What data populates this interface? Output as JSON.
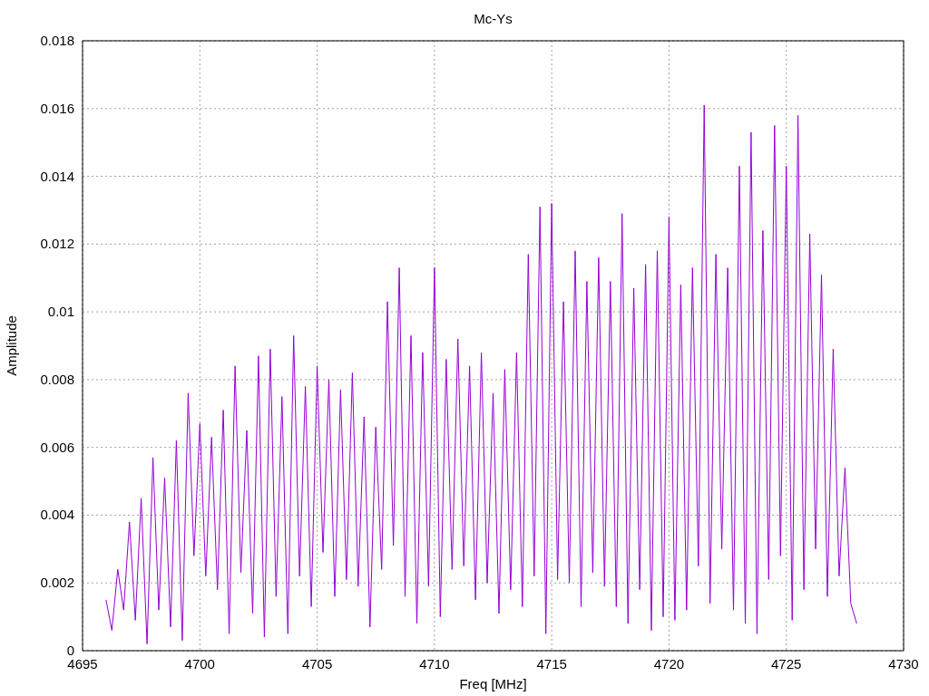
{
  "chart_data": {
    "type": "line",
    "title": "Mc-Ys",
    "xlabel": "Freq [MHz]",
    "ylabel": "Amplitude",
    "grid": true,
    "xlim": [
      4695,
      4730
    ],
    "ylim": [
      0,
      0.018
    ],
    "xticks": [
      4695,
      4700,
      4705,
      4710,
      4715,
      4720,
      4725,
      4730
    ],
    "yticks": [
      0,
      0.002,
      0.004,
      0.006,
      0.008,
      0.01,
      0.012,
      0.014,
      0.016,
      0.018
    ],
    "x": [
      4696,
      4696.25,
      4696.5,
      4696.75,
      4697,
      4697.25,
      4697.5,
      4697.75,
      4698,
      4698.25,
      4698.5,
      4698.75,
      4699,
      4699.25,
      4699.5,
      4699.75,
      4700,
      4700.25,
      4700.5,
      4700.75,
      4701,
      4701.25,
      4701.5,
      4701.75,
      4702,
      4702.25,
      4702.5,
      4702.75,
      4703,
      4703.25,
      4703.5,
      4703.75,
      4704,
      4704.25,
      4704.5,
      4704.75,
      4705,
      4705.25,
      4705.5,
      4705.75,
      4706,
      4706.25,
      4706.5,
      4706.75,
      4707,
      4707.25,
      4707.5,
      4707.75,
      4708,
      4708.25,
      4708.5,
      4708.75,
      4709,
      4709.25,
      4709.5,
      4709.75,
      4710,
      4710.25,
      4710.5,
      4710.75,
      4711,
      4711.25,
      4711.5,
      4711.75,
      4712,
      4712.25,
      4712.5,
      4712.75,
      4713,
      4713.25,
      4713.5,
      4713.75,
      4714,
      4714.25,
      4714.5,
      4714.75,
      4715,
      4715.25,
      4715.5,
      4715.75,
      4716,
      4716.25,
      4716.5,
      4716.75,
      4717,
      4717.25,
      4717.5,
      4717.75,
      4718,
      4718.25,
      4718.5,
      4718.75,
      4719,
      4719.25,
      4719.5,
      4719.75,
      4720,
      4720.25,
      4720.5,
      4720.75,
      4721,
      4721.25,
      4721.5,
      4721.75,
      4722,
      4722.25,
      4722.5,
      4722.75,
      4723,
      4723.25,
      4723.5,
      4723.75,
      4724,
      4724.25,
      4724.5,
      4724.75,
      4725,
      4725.25,
      4725.5,
      4725.75,
      4726,
      4726.25,
      4726.5,
      4726.75,
      4727,
      4727.25,
      4727.5,
      4727.75,
      4728
    ],
    "series": [
      {
        "color": "#9400d3",
        "values": [
          0.0015,
          0.0006,
          0.0024,
          0.0012,
          0.0038,
          0.0009,
          0.0045,
          0.0002,
          0.0057,
          0.0012,
          0.0051,
          0.0007,
          0.0062,
          0.0003,
          0.0076,
          0.0028,
          0.0067,
          0.0022,
          0.0063,
          0.0018,
          0.0071,
          0.0005,
          0.0084,
          0.0023,
          0.0065,
          0.0011,
          0.0087,
          0.0004,
          0.0089,
          0.0016,
          0.0075,
          0.0005,
          0.0093,
          0.0022,
          0.0078,
          0.0013,
          0.0084,
          0.0029,
          0.008,
          0.0016,
          0.0077,
          0.0021,
          0.0082,
          0.0019,
          0.0069,
          0.0007,
          0.0066,
          0.0024,
          0.0103,
          0.0031,
          0.0113,
          0.0016,
          0.0093,
          0.0008,
          0.0088,
          0.0019,
          0.0113,
          0.001,
          0.0086,
          0.0024,
          0.0092,
          0.0025,
          0.0084,
          0.0015,
          0.0088,
          0.002,
          0.0076,
          0.0011,
          0.0083,
          0.0018,
          0.0088,
          0.0013,
          0.0117,
          0.0022,
          0.0131,
          0.0005,
          0.0132,
          0.0021,
          0.0103,
          0.002,
          0.0118,
          0.0013,
          0.0109,
          0.0023,
          0.0116,
          0.0019,
          0.0109,
          0.0013,
          0.0129,
          0.0008,
          0.0107,
          0.0018,
          0.0114,
          0.0006,
          0.0118,
          0.001,
          0.0128,
          0.0009,
          0.0108,
          0.0012,
          0.0113,
          0.0025,
          0.0161,
          0.0014,
          0.0117,
          0.003,
          0.0113,
          0.0012,
          0.0143,
          0.0008,
          0.0153,
          0.0005,
          0.0124,
          0.0021,
          0.0155,
          0.0028,
          0.0143,
          0.0009,
          0.0158,
          0.0018,
          0.0123,
          0.003,
          0.0111,
          0.0016,
          0.0089,
          0.0022,
          0.0054,
          0.0014,
          0.0008
        ]
      }
    ]
  }
}
